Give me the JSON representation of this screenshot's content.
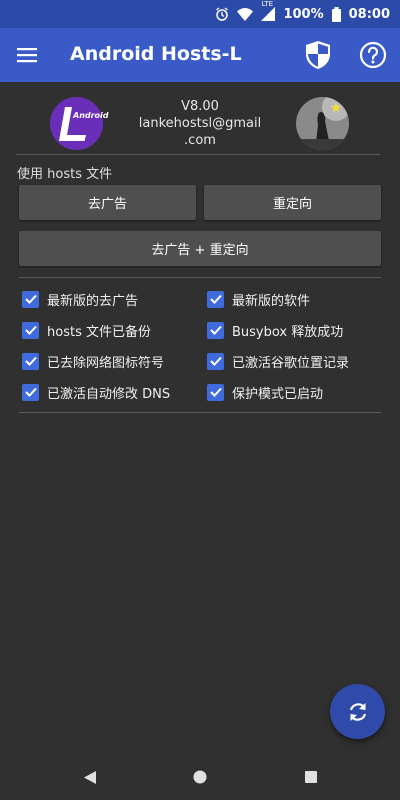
{
  "status_bar": {
    "battery": "100%",
    "time": "08:00",
    "network": "LTE"
  },
  "app_bar": {
    "title": "Android Hosts-L",
    "icons": [
      "menu-icon",
      "shield-icon",
      "help-icon"
    ]
  },
  "header": {
    "logo_text": "Android",
    "version": "V8.00",
    "email_line1": "lankehostsl@gmail",
    "email_line2": ".com"
  },
  "section_label": "使用 hosts 文件",
  "buttons": {
    "adblock": "去广告",
    "redirect": "重定向",
    "both": "去广告 + 重定向"
  },
  "checks": [
    {
      "label": "最新版的去广告",
      "checked": true
    },
    {
      "label": "最新版的软件",
      "checked": true
    },
    {
      "label": "hosts 文件已备份",
      "checked": true
    },
    {
      "label": "Busybox 释放成功",
      "checked": true
    },
    {
      "label": "已去除网络图标符号",
      "checked": true
    },
    {
      "label": "已激活谷歌位置记录",
      "checked": true
    },
    {
      "label": "已激活自动修改 DNS",
      "checked": true
    },
    {
      "label": "保护模式已启动",
      "checked": true
    }
  ],
  "colors": {
    "accent": "#3a5bc7",
    "status_bar": "#2c4aa8",
    "background": "#303030",
    "checkbox": "#3f6bdc"
  }
}
